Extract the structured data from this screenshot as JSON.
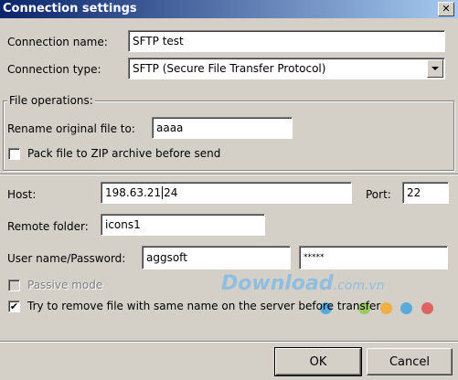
{
  "window": {
    "title": "Connection settings"
  },
  "connection": {
    "name_label": "Connection name:",
    "name_value": "SFTP test",
    "type_label": "Connection type:",
    "type_value": "SFTP (Secure File Transfer Protocol)"
  },
  "file_operations": {
    "group_title": "File operations:",
    "rename_label": "Rename original file to:",
    "rename_value": "aaaa",
    "zip_label": "Pack file to ZIP archive before send",
    "zip_checked": false
  },
  "server": {
    "host_label": "Host:",
    "host_value_a": "198.63.21",
    "host_value_b": "24",
    "port_label": "Port:",
    "port_value": "22",
    "remote_folder_label": "Remote folder:",
    "remote_folder_value": "icons1",
    "user_label": "User name/Password:",
    "user_value": "aggsoft",
    "password_value": "*****",
    "passive_label": "Passive mode",
    "passive_checked": false,
    "remove_label": "Try to remove file with same name on the server before transfer",
    "remove_checked": true,
    "check_mark": "✔"
  },
  "buttons": {
    "ok": "OK",
    "cancel": "Cancel"
  },
  "icons": {
    "close": "close-icon",
    "dropdown": "chevron-down-icon"
  },
  "watermark": {
    "brand": "Download",
    "suffix": ".com.vn",
    "dot_colors": [
      "#3aa0e0",
      "#8cc84b",
      "#f5a623",
      "#3aa0e0",
      "#e04848"
    ]
  }
}
